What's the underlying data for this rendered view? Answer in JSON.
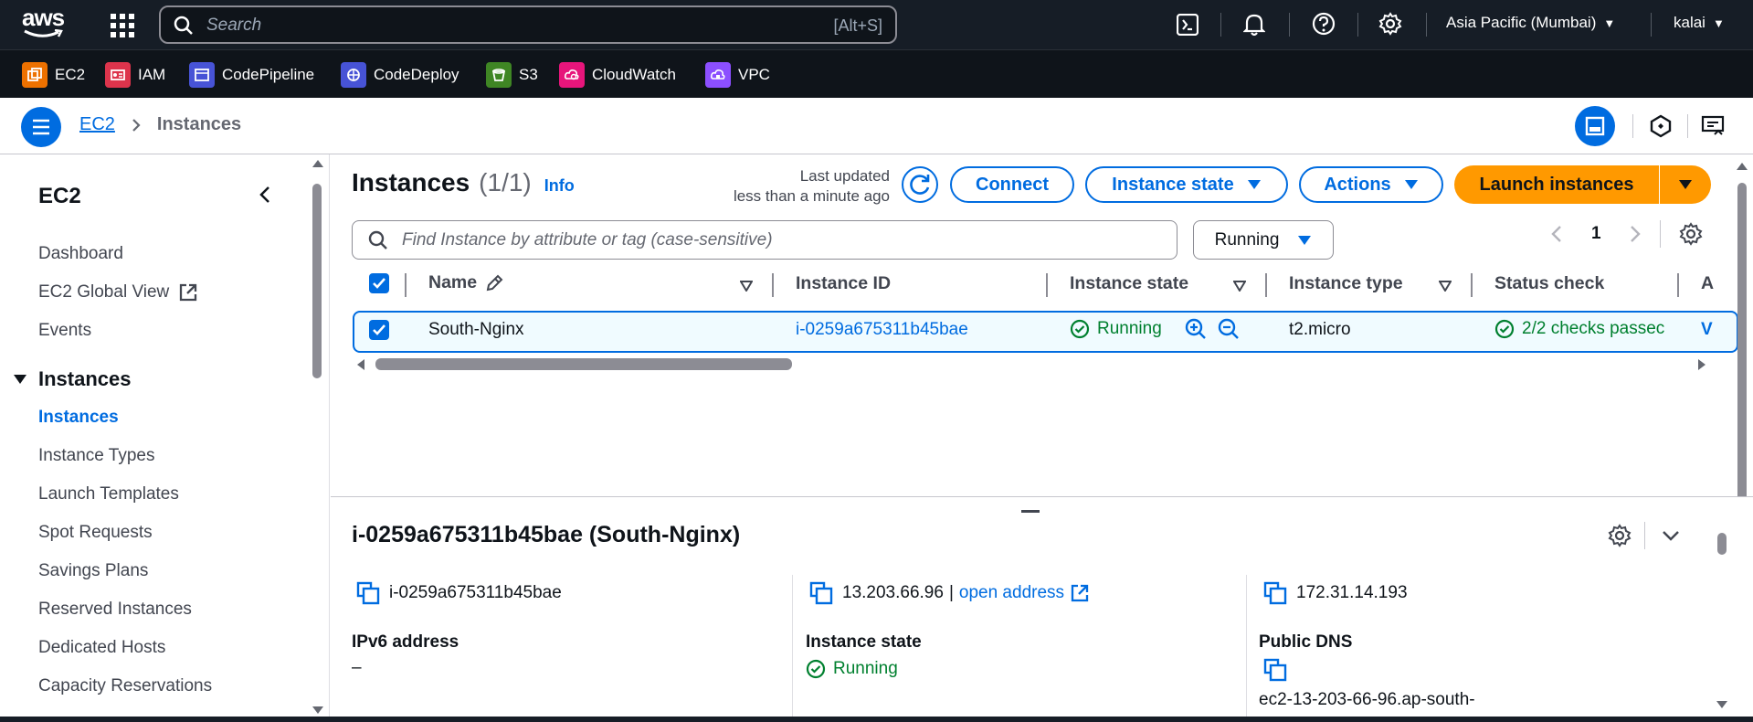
{
  "topnav": {
    "logo_text": "aws",
    "search_placeholder": "Search",
    "search_shortcut": "[Alt+S]",
    "region": "Asia Pacific (Mumbai)",
    "user": "kalai"
  },
  "favorites": [
    {
      "label": "EC2",
      "color": "#ed7100"
    },
    {
      "label": "IAM",
      "color": "#dd344c"
    },
    {
      "label": "CodePipeline",
      "color": "#4753d6"
    },
    {
      "label": "CodeDeploy",
      "color": "#4753d6"
    },
    {
      "label": "S3",
      "color": "#3f8624"
    },
    {
      "label": "CloudWatch",
      "color": "#e7157b"
    },
    {
      "label": "VPC",
      "color": "#8c4fff"
    }
  ],
  "breadcrumb": {
    "root": "EC2",
    "current": "Instances"
  },
  "sidebar": {
    "title": "EC2",
    "items": [
      "Dashboard",
      "EC2 Global View",
      "Events"
    ],
    "section": "Instances",
    "section_items": [
      "Instances",
      "Instance Types",
      "Launch Templates",
      "Spot Requests",
      "Savings Plans",
      "Reserved Instances",
      "Dedicated Hosts",
      "Capacity Reservations"
    ]
  },
  "main": {
    "title": "Instances",
    "count": "(1/1)",
    "info": "Info",
    "last_updated_label": "Last updated",
    "last_updated_value": "less than a minute ago",
    "buttons": {
      "connect": "Connect",
      "instance_state": "Instance state",
      "actions": "Actions",
      "launch": "Launch instances"
    },
    "filter_placeholder": "Find Instance by attribute or tag (case-sensitive)",
    "state_filter": "Running",
    "page": "1",
    "columns": [
      "Name",
      "Instance ID",
      "Instance state",
      "Instance type",
      "Status check",
      "A"
    ],
    "rows": [
      {
        "name": "South-Nginx",
        "instance_id": "i-0259a675311b45bae",
        "state": "Running",
        "type": "t2.micro",
        "status_check": "2/2 checks passec",
        "extra": "V"
      }
    ]
  },
  "details": {
    "title": "i-0259a675311b45bae (South-Nginx)",
    "col1_value": "i-0259a675311b45bae",
    "col2_ip": "13.203.66.96",
    "col2_sep": "|",
    "col2_link": "open address",
    "col3_value": "172.31.14.193",
    "ipv6_label": "IPv6 address",
    "ipv6_value": "–",
    "state_label": "Instance state",
    "state_value": "Running",
    "dns_label": "Public DNS",
    "dns_value": "ec2-13-203-66-96.ap-south-"
  },
  "colors": {
    "accent": "#006ce0",
    "launch": "#ff9900",
    "running": "#00802f",
    "nav": "#161d26"
  }
}
